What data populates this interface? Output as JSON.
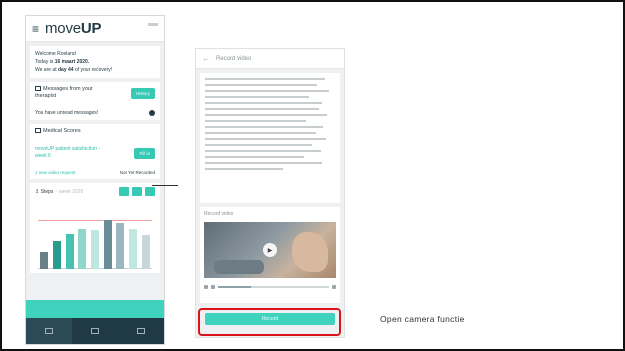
{
  "phone1": {
    "logo_prefix": "move",
    "logo_suffix": "UP",
    "welcome": {
      "greeting": "Welcome Roeland",
      "today_prefix": "Today is ",
      "today_date": "16 maart 2020.",
      "day_prefix": "We are at ",
      "day_value": "day 44",
      "day_suffix": " of your recovery!"
    },
    "messages": {
      "title": "Messages from your therapist",
      "history_button": "History",
      "unread_text": "You have unread messages!"
    },
    "medical": {
      "title": "Medical Scores",
      "survey_title": "moveUP patient satisfaction - week 6",
      "fill_button": "Fill in",
      "video_request": "1 new video request",
      "video_status": "Not Yet Recorded"
    },
    "steps": {
      "title": "Steps",
      "range": "week 2020"
    },
    "steps_chart": {
      "values": [
        0.3,
        0.5,
        0.62,
        0.72,
        0.7,
        0.88,
        0.82,
        0.72,
        0.6
      ],
      "goal": 0.88
    },
    "colors": {
      "accent": "#36c9b4",
      "navy": "#1f3a44",
      "bar_colors": [
        "#6a8088",
        "#2a9c8d",
        "#48c2b0",
        "#8fd6cc",
        "#bde7e1",
        "#6a8c99",
        "#9db6bf",
        "#bfe8e2",
        "#c8d5d9"
      ]
    }
  },
  "phone2": {
    "header_title": "Record video",
    "video_label": "Record video",
    "camera_button": "Record"
  },
  "caption": "Open camera functie"
}
